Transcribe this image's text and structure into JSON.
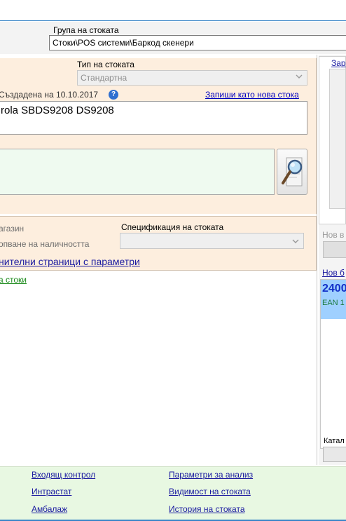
{
  "group": {
    "label": "Група на стоката",
    "value": "Стоки\\POS системи\\Баркод скенери"
  },
  "type": {
    "label": "Тип на стоката",
    "value": "Стандартна"
  },
  "created": "Създадена на 10.10.2017",
  "help_icon": "?",
  "save_as_new": "Запиши като нова стока",
  "product_name": "rola SBDS9208 DS9208",
  "store_label": "агазин",
  "stock_label": "опване на наличността",
  "spec_label": "Спецификация на стоката",
  "extra_pages": "нителни страници с параметри",
  "stocks_link": "а стоки",
  "right": {
    "top_link": "Зар",
    "new_in": "Нов в",
    "new_b": "Нов б",
    "barcode_num": "2400",
    "barcode_ean": "EAN 1",
    "catalog": "Катал"
  },
  "footer": {
    "left": [
      "Входящ контрол",
      "Интрастат",
      "Амбалаж"
    ],
    "right": [
      "Параметри за анализ",
      "Видимост на стоката",
      "История на стоката"
    ]
  },
  "colors": {
    "accent": "#3a86c8",
    "peach": "#fdeede",
    "footer_bg": "#e8f8e2",
    "barcode_bg": "#9fd0ff"
  }
}
